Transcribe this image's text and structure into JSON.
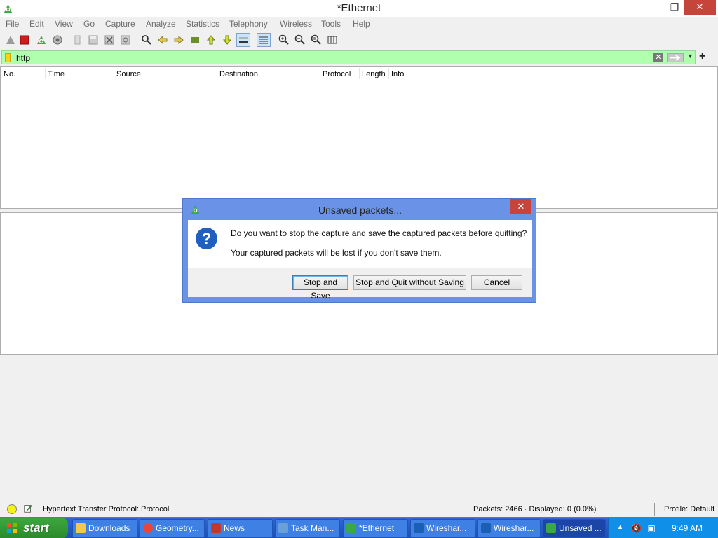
{
  "window": {
    "title": "*Ethernet",
    "min_glyph": "—",
    "max_glyph": "❐",
    "close_glyph": "✕"
  },
  "menu": [
    "File",
    "Edit",
    "View",
    "Go",
    "Capture",
    "Analyze",
    "Statistics",
    "Telephony",
    "Wireless",
    "Tools",
    "Help"
  ],
  "toolbar": [
    "start-capture-icon",
    "stop-capture-icon",
    "restart-capture-icon",
    "capture-options-icon",
    "open-file-icon",
    "save-file-icon",
    "close-file-icon",
    "reload-file-icon",
    "find-packet-icon",
    "go-back-icon",
    "go-forward-icon",
    "go-to-packet-icon",
    "first-packet-icon",
    "last-packet-icon",
    "auto-scroll-icon",
    "colorize-icon",
    "zoom-in-icon",
    "zoom-out-icon",
    "normal-size-icon",
    "resize-columns-icon"
  ],
  "filter": {
    "value": "http",
    "clear_glyph": "✕",
    "drop_glyph": "▼",
    "add_glyph": "+"
  },
  "columns": [
    "No.",
    "Time",
    "Source",
    "Destination",
    "Protocol",
    "Length",
    "Info"
  ],
  "status": {
    "field_info": "Hypertext Transfer Protocol: Protocol",
    "packets": "Packets: 2466 · Displayed: 0 (0.0%)",
    "profile": "Profile: Default"
  },
  "dialog": {
    "title": "Unsaved packets...",
    "close_glyph": "✕",
    "icon_glyph": "?",
    "message": "Do you want to stop the capture and save the captured packets before quitting?",
    "detail": "Your captured packets will be lost if you don't save them.",
    "buttons": {
      "stop_save": "Stop and Save",
      "stop_quit": "Stop and Quit without Saving",
      "cancel": "Cancel"
    }
  },
  "taskbar": {
    "start_label": "start",
    "items": [
      {
        "label": "Downloads",
        "icon": "folder-icon",
        "color": "#f2c94c"
      },
      {
        "label": "Geometry...",
        "icon": "chrome-icon",
        "color": "#e8453c"
      },
      {
        "label": "News",
        "icon": "news-icon",
        "color": "#c0392b"
      },
      {
        "label": "Task Man...",
        "icon": "task-manager-icon",
        "color": "#6aa0d8"
      },
      {
        "label": "*Ethernet",
        "icon": "wireshark-icon",
        "color": "#3aa845"
      },
      {
        "label": "Wireshar...",
        "icon": "wireshark-fin-icon",
        "color": "#1a5fb4"
      },
      {
        "label": "Wireshar...",
        "icon": "wireshark-fin-icon",
        "color": "#1a5fb4"
      },
      {
        "label": "Unsaved ...",
        "icon": "wireshark-icon",
        "color": "#3aa845"
      }
    ],
    "tray_chevron": "▲",
    "volume_glyph": "🔇",
    "network_glyph": "▣",
    "clock": "9:49 AM"
  },
  "colors": {
    "filter_valid": "#afffaf",
    "dialog_frame": "#6a92e6",
    "taskbar": "#2458c8",
    "start": "#3da73f"
  }
}
